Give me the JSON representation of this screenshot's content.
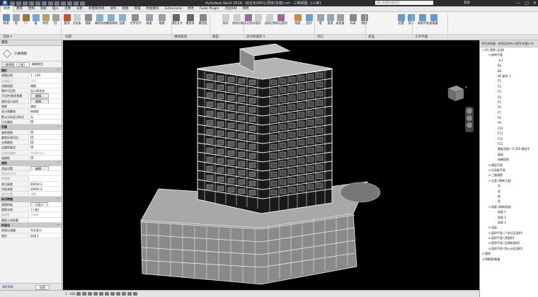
{
  "titlebar": {
    "app_logo": "R",
    "title": "Autodesk Revit 2016 - 综合实训中心项目(东楼).rvt - 三维视图: {三维}",
    "search_placeholder": "键入关键字或短语",
    "user": "登录",
    "min": "—",
    "max": "□",
    "close": "✕"
  },
  "menu": [
    "修改",
    "建筑",
    "结构",
    "系统",
    "插入",
    "注释",
    "分析",
    "体量和场地",
    "协作",
    "视图",
    "管理",
    "附加模块",
    "Extensions",
    "修改",
    "Fuzor Plugin",
    "鸿业BIM",
    "修改"
  ],
  "menu_active_index": 0,
  "ribbon": {
    "buttons": [
      {
        "label": "修改",
        "color": "#6a8fb8"
      },
      {
        "label": "墙",
        "color": "#9aa4ad"
      },
      {
        "label": "门",
        "color": "#9c7446"
      },
      {
        "label": "窗",
        "color": "#79a6cf"
      },
      {
        "label": "构件",
        "color": "#b0a070"
      },
      {
        "label": "柱",
        "color": "#a0a0a0"
      },
      {
        "label": "屋顶",
        "color": "#b85a3a"
      },
      {
        "label": "天花板",
        "color": "#cfcfcf"
      },
      {
        "label": "楼板",
        "color": "#8c8c8c"
      },
      {
        "label": "幕墙系统",
        "color": "#7fb0cf"
      },
      {
        "label": "幕墙网格",
        "color": "#7fb0cf"
      },
      {
        "label": "竖梃",
        "color": "#8ab2cc"
      },
      {
        "label": "栏杆扶手",
        "color": "#8c9096"
      },
      {
        "label": "坡道",
        "color": "#9aa0a8"
      },
      {
        "label": "楼梯",
        "color": "#9aa0a8"
      },
      {
        "label": "模型文字",
        "color": "#666"
      },
      {
        "label": "模型线",
        "color": "#666"
      },
      {
        "label": "模型组",
        "color": "#888"
      },
      {
        "label": "房间",
        "color": "#ccc"
      },
      {
        "label": "房间分隔",
        "color": "#ccc"
      },
      {
        "label": "标记房间",
        "color": "#9a6a9a"
      },
      {
        "label": "面积",
        "color": "#ccc"
      },
      {
        "label": "面积边界",
        "color": "#ccc"
      },
      {
        "label": "标记面积",
        "color": "#9a6a9a"
      },
      {
        "label": "按面",
        "color": "#c98a4a"
      },
      {
        "label": "竖井",
        "color": "#6aa0c9"
      },
      {
        "label": "墙",
        "color": "#9aa4ad"
      },
      {
        "label": "垂直",
        "color": "#9aa4ad"
      },
      {
        "label": "老虎窗",
        "color": "#9aa4ad"
      },
      {
        "label": "标高",
        "color": "#888"
      },
      {
        "label": "轴网",
        "color": "#888"
      },
      {
        "label": "设置",
        "color": "#6a9ac9"
      },
      {
        "label": "显示",
        "color": "#6a9ac9"
      },
      {
        "label": "参照平面",
        "color": "#6a9ac9"
      },
      {
        "label": "查看器",
        "color": "#6a9ac9"
      }
    ],
    "groups": [
      "选择 ▾",
      "构建",
      "楼梯坡道",
      "模型",
      "房间和面积 ▾",
      "洞口",
      "基准",
      "工作平面"
    ]
  },
  "properties": {
    "header": "属性",
    "type_name": "三维视图",
    "view_selector": "三维视图: {三维}",
    "edit_type": "编辑类型",
    "sections": [
      {
        "title": "图形",
        "rows": [
          {
            "k": "视图比例",
            "v": "1 : 100"
          },
          {
            "k": "比例值 1:",
            "v": "100",
            "dim": true
          },
          {
            "k": "详细程度",
            "v": "精细"
          },
          {
            "k": "零件可见性",
            "v": "显示原状态"
          },
          {
            "k": "可见性/图形替换",
            "v": "编辑...",
            "btn": true
          },
          {
            "k": "图形显示选项",
            "v": "编辑...",
            "btn": true
          },
          {
            "k": "规程",
            "v": "建筑"
          },
          {
            "k": "显示隐藏线",
            "v": "按规程"
          },
          {
            "k": "默认分析显示样式",
            "v": "无"
          },
          {
            "k": "日光路径",
            "v": "",
            "chk": true
          }
        ]
      },
      {
        "title": "范围",
        "rows": [
          {
            "k": "裁剪视图",
            "v": "",
            "chk": true
          },
          {
            "k": "裁剪区域可见",
            "v": "",
            "chk": true
          },
          {
            "k": "注释裁剪",
            "v": "",
            "chk": true
          },
          {
            "k": "远裁剪激活",
            "v": "",
            "chk": true
          },
          {
            "k": "远裁剪偏移",
            "v": "304800.0",
            "dim": true
          },
          {
            "k": "剖面框",
            "v": "",
            "chk": true
          }
        ]
      },
      {
        "title": "相机",
        "rows": [
          {
            "k": "渲染设置",
            "v": "编辑...",
            "btn": true
          },
          {
            "k": "锁定的方向",
            "v": "",
            "dim": true
          },
          {
            "k": "透视图",
            "v": "",
            "dim": true
          },
          {
            "k": "视点高度",
            "v": "60418.3"
          },
          {
            "k": "目标高度",
            "v": "26600.0"
          },
          {
            "k": "相机位置",
            "v": "调整",
            "dim": true
          }
        ]
      },
      {
        "title": "标识数据",
        "rows": [
          {
            "k": "视图样板",
            "v": "<无>",
            "btn": true
          },
          {
            "k": "视图名称",
            "v": "{三维}"
          },
          {
            "k": "相关性",
            "v": "不相关",
            "dim": true
          },
          {
            "k": "图纸上的标题",
            "v": ""
          }
        ]
      },
      {
        "title": "阶段化",
        "rows": [
          {
            "k": "阶段过滤器",
            "v": "完全显示"
          },
          {
            "k": "相位",
            "v": "阶段 1"
          }
        ]
      }
    ],
    "help_link": "属性帮助",
    "apply": "应用"
  },
  "viewbar": {
    "scale": "1 : 100"
  },
  "browser": {
    "header": "项目浏览器 - 综合实训中心项目(东楼).rvt",
    "nodes": [
      {
        "t": "⊟",
        "d": 0,
        "label": "[0] 视图 (全部)"
      },
      {
        "t": "⊟",
        "d": 1,
        "label": "结构平面"
      },
      {
        "t": "",
        "d": 2,
        "label": "-4.2"
      },
      {
        "t": "",
        "d": 2,
        "label": "B1"
      },
      {
        "t": "",
        "d": 2,
        "label": "B2"
      },
      {
        "t": "",
        "d": 2,
        "label": "B2 副本 1"
      },
      {
        "t": "",
        "d": 2,
        "label": "F1"
      },
      {
        "t": "",
        "d": 2,
        "label": "F2"
      },
      {
        "t": "",
        "d": 2,
        "label": "F3"
      },
      {
        "t": "",
        "d": 2,
        "label": "F4"
      },
      {
        "t": "",
        "d": 2,
        "label": "F5"
      },
      {
        "t": "",
        "d": 2,
        "label": "F6"
      },
      {
        "t": "",
        "d": 2,
        "label": "F7"
      },
      {
        "t": "",
        "d": 2,
        "label": "F8"
      },
      {
        "t": "",
        "d": 2,
        "label": "F9"
      },
      {
        "t": "",
        "d": 2,
        "label": "F10"
      },
      {
        "t": "",
        "d": 2,
        "label": "F11"
      },
      {
        "t": "",
        "d": 2,
        "label": "F12"
      },
      {
        "t": "",
        "d": 2,
        "label": "F13"
      },
      {
        "t": "",
        "d": 2,
        "label": "基础顶面~-5.350 楼柱平"
      },
      {
        "t": "",
        "d": 2,
        "label": "屋面"
      },
      {
        "t": "",
        "d": 2,
        "label": "电梯机房"
      },
      {
        "t": "⊞",
        "d": 1,
        "label": "楼层平面"
      },
      {
        "t": "⊞",
        "d": 1,
        "label": "天花板平面"
      },
      {
        "t": "⊞",
        "d": 1,
        "label": "三维视图"
      },
      {
        "t": "⊟",
        "d": 1,
        "label": "立面 (建筑立面)"
      },
      {
        "t": "",
        "d": 2,
        "label": "东"
      },
      {
        "t": "",
        "d": 2,
        "label": "北"
      },
      {
        "t": "",
        "d": 2,
        "label": "南"
      },
      {
        "t": "",
        "d": 2,
        "label": "西"
      },
      {
        "t": "⊟",
        "d": 1,
        "label": "剖面 (建筑剖面)"
      },
      {
        "t": "",
        "d": 2,
        "label": "剖面 1"
      },
      {
        "t": "",
        "d": 2,
        "label": "剖面 2"
      },
      {
        "t": "",
        "d": 2,
        "label": "剖面 3"
      },
      {
        "t": "⊞",
        "d": 1,
        "label": "渲染"
      },
      {
        "t": "⊞",
        "d": 1,
        "label": "面积平面 (人防分区面积)"
      },
      {
        "t": "⊞",
        "d": 1,
        "label": "面积平面 (净面积)"
      },
      {
        "t": "⊞",
        "d": 1,
        "label": "面积平面 (总建筑面积)"
      },
      {
        "t": "⊞",
        "d": 1,
        "label": "面积平面 (防火分区面积)"
      },
      {
        "t": "⊞",
        "d": 0,
        "label": "图例"
      },
      {
        "t": "⊞",
        "d": 0,
        "label": "明细表/数量"
      }
    ]
  }
}
